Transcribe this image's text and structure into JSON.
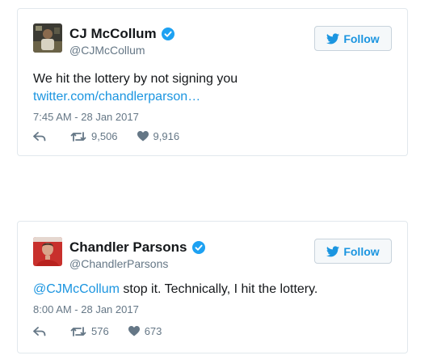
{
  "tweets": [
    {
      "name": "CJ McCollum",
      "handle": "@CJMcCollum",
      "follow_label": "Follow",
      "text": "We hit the lottery by not signing you",
      "link": "twitter.com/chandlerparson…",
      "timestamp": "7:45 AM - 28 Jan 2017",
      "retweets": "9,506",
      "likes": "9,916"
    },
    {
      "name": "Chandler Parsons",
      "handle": "@ChandlerParsons",
      "follow_label": "Follow",
      "mention": "@CJMcCollum",
      "text": " stop it. Technically, I hit the lottery.",
      "timestamp": "8:00 AM - 28 Jan 2017",
      "retweets": "576",
      "likes": "673"
    }
  ],
  "colors": {
    "accent": "#1b95e0",
    "muted": "#657786",
    "border": "#e1e8ed"
  },
  "icons": [
    "verified-badge-icon",
    "twitter-bird-icon",
    "reply-icon",
    "retweet-icon",
    "heart-icon"
  ]
}
